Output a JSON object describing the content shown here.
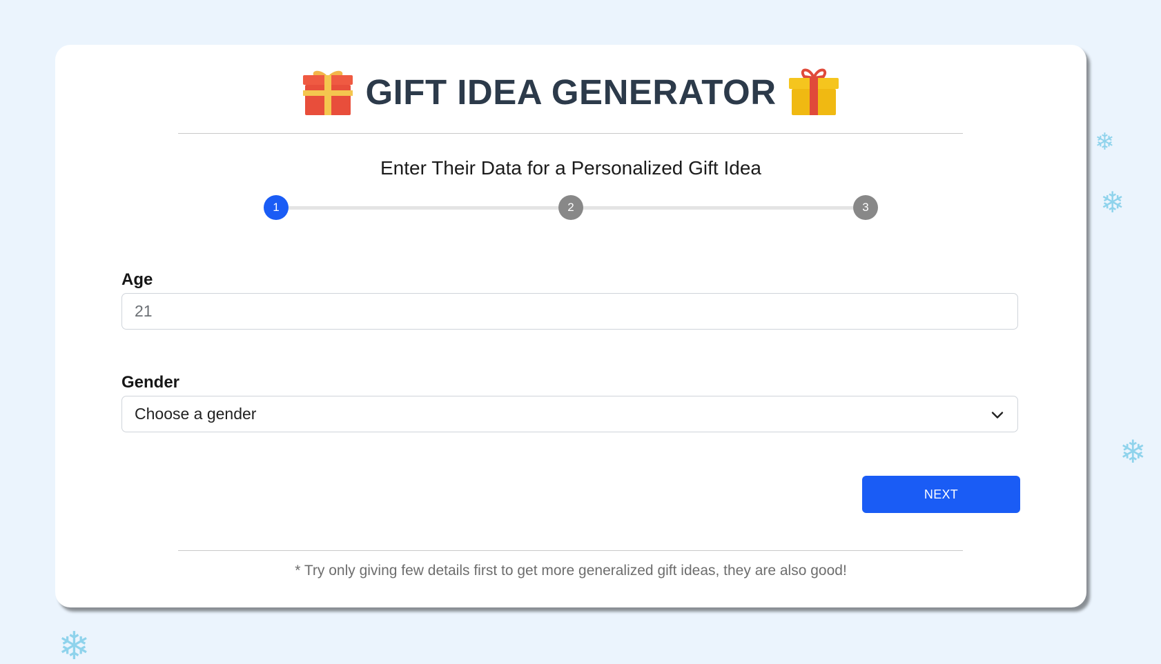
{
  "header": {
    "title": "GIFT IDEA GENERATOR",
    "left_icon": "gift-red-icon",
    "right_icon": "gift-yellow-icon"
  },
  "subtitle": "Enter Their Data for a Personalized Gift Idea",
  "stepper": {
    "steps": [
      "1",
      "2",
      "3"
    ],
    "active_step": 1
  },
  "form": {
    "age": {
      "label": "Age",
      "value": "21"
    },
    "gender": {
      "label": "Gender",
      "selected": "Choose a gender"
    }
  },
  "next_button": "NEXT",
  "footnote": "* Try only giving few details first to get more generalized gift ideas, they are also good!",
  "colors": {
    "background": "#ebf4fd",
    "accent": "#1a5cf5",
    "inactive_step": "#888888",
    "title": "#2c3a4a",
    "snowflake": "#8fd3ec"
  },
  "decorations": {
    "snowflake_glyph": "❄"
  }
}
